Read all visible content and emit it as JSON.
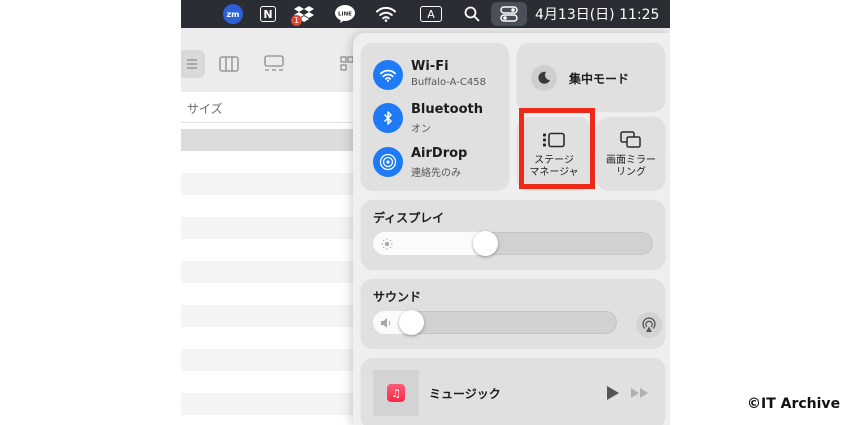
{
  "menubar": {
    "zoom_label": "zm",
    "notion_label": "N",
    "dropbox_badge": "1",
    "line_label": "LINE",
    "input_label": "A",
    "datetime": "4月13日(日) 11:25",
    "icons": [
      "zoom-icon",
      "notion-icon",
      "dropbox-icon",
      "line-icon",
      "wifi-icon",
      "input-source-icon",
      "search-icon",
      "control-center-icon"
    ]
  },
  "finder": {
    "column_header": "サイズ"
  },
  "control_center": {
    "wifi": {
      "title": "Wi-Fi",
      "sub": "Buffalo-A-C458",
      "color": "#1e7bf5"
    },
    "bluetooth": {
      "title": "Bluetooth",
      "sub": "オン"
    },
    "airdrop": {
      "title": "AirDrop",
      "sub": "連絡先のみ"
    },
    "focus": {
      "label": "集中モード"
    },
    "stage_manager": {
      "label_line1": "ステージ",
      "label_line2": "マネージャ"
    },
    "screen_mirroring": {
      "label_line1": "画面ミラー",
      "label_line2": "リング"
    },
    "display": {
      "title": "ディスプレイ",
      "level": 0.38
    },
    "sound": {
      "title": "サウンド",
      "level": 0.13
    },
    "music": {
      "label": "ミュージック"
    },
    "highlight_color": "#ec2a17"
  },
  "credit": "©IT Archive"
}
